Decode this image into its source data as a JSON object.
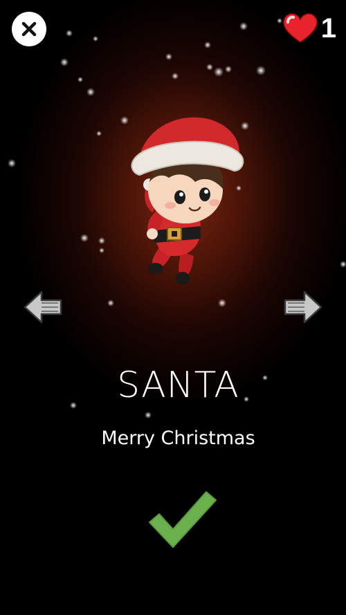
{
  "hud": {
    "close_icon": "close-icon",
    "heart_icon": "heart-icon",
    "lives": "1"
  },
  "character": {
    "name": "SANTA",
    "subtitle": "Merry Christmas"
  },
  "navigation": {
    "previous_icon": "arrow-left-icon",
    "next_icon": "arrow-right-icon"
  },
  "confirm": {
    "icon": "checkmark-icon",
    "color": "#6ab04c"
  },
  "colors": {
    "background": "#000000",
    "glow": "#7a2410",
    "heart": "#e8232b",
    "text": "#ffffff"
  }
}
